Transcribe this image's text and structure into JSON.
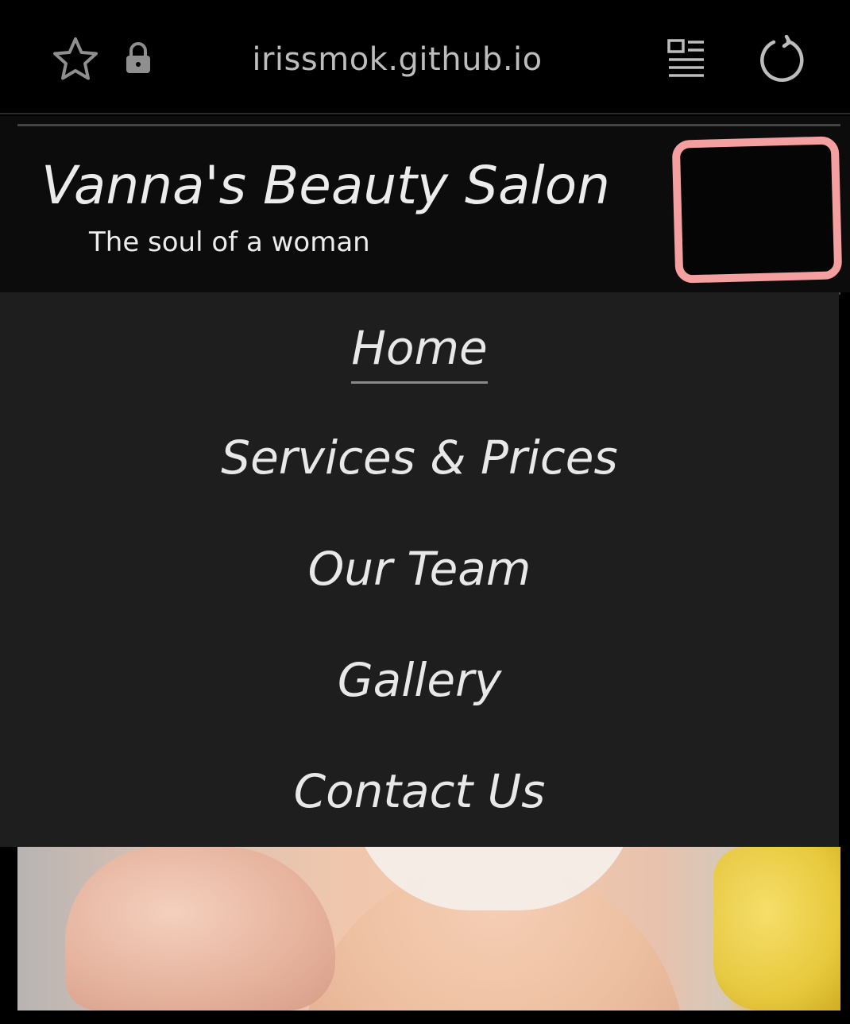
{
  "browser": {
    "url": "irissmok.github.io",
    "icons": {
      "bookmark": "star-icon",
      "security": "lock-icon",
      "reader_mode": "reader-mode-icon",
      "reload": "reload-icon"
    }
  },
  "header": {
    "title": "Vanna's Beauty Salon",
    "tagline": "The soul of a woman",
    "redaction_color": "#f4a0a0"
  },
  "nav": {
    "items": [
      {
        "label": "Home",
        "active": true
      },
      {
        "label": "Services & Prices",
        "active": false
      },
      {
        "label": "Our Team",
        "active": false
      },
      {
        "label": "Gallery",
        "active": false
      },
      {
        "label": "Contact Us",
        "active": false
      }
    ]
  },
  "colors": {
    "page_background": "#000000",
    "header_background": "#0c0c0c",
    "nav_background": "#1e1e1e",
    "text": "#ececec"
  }
}
